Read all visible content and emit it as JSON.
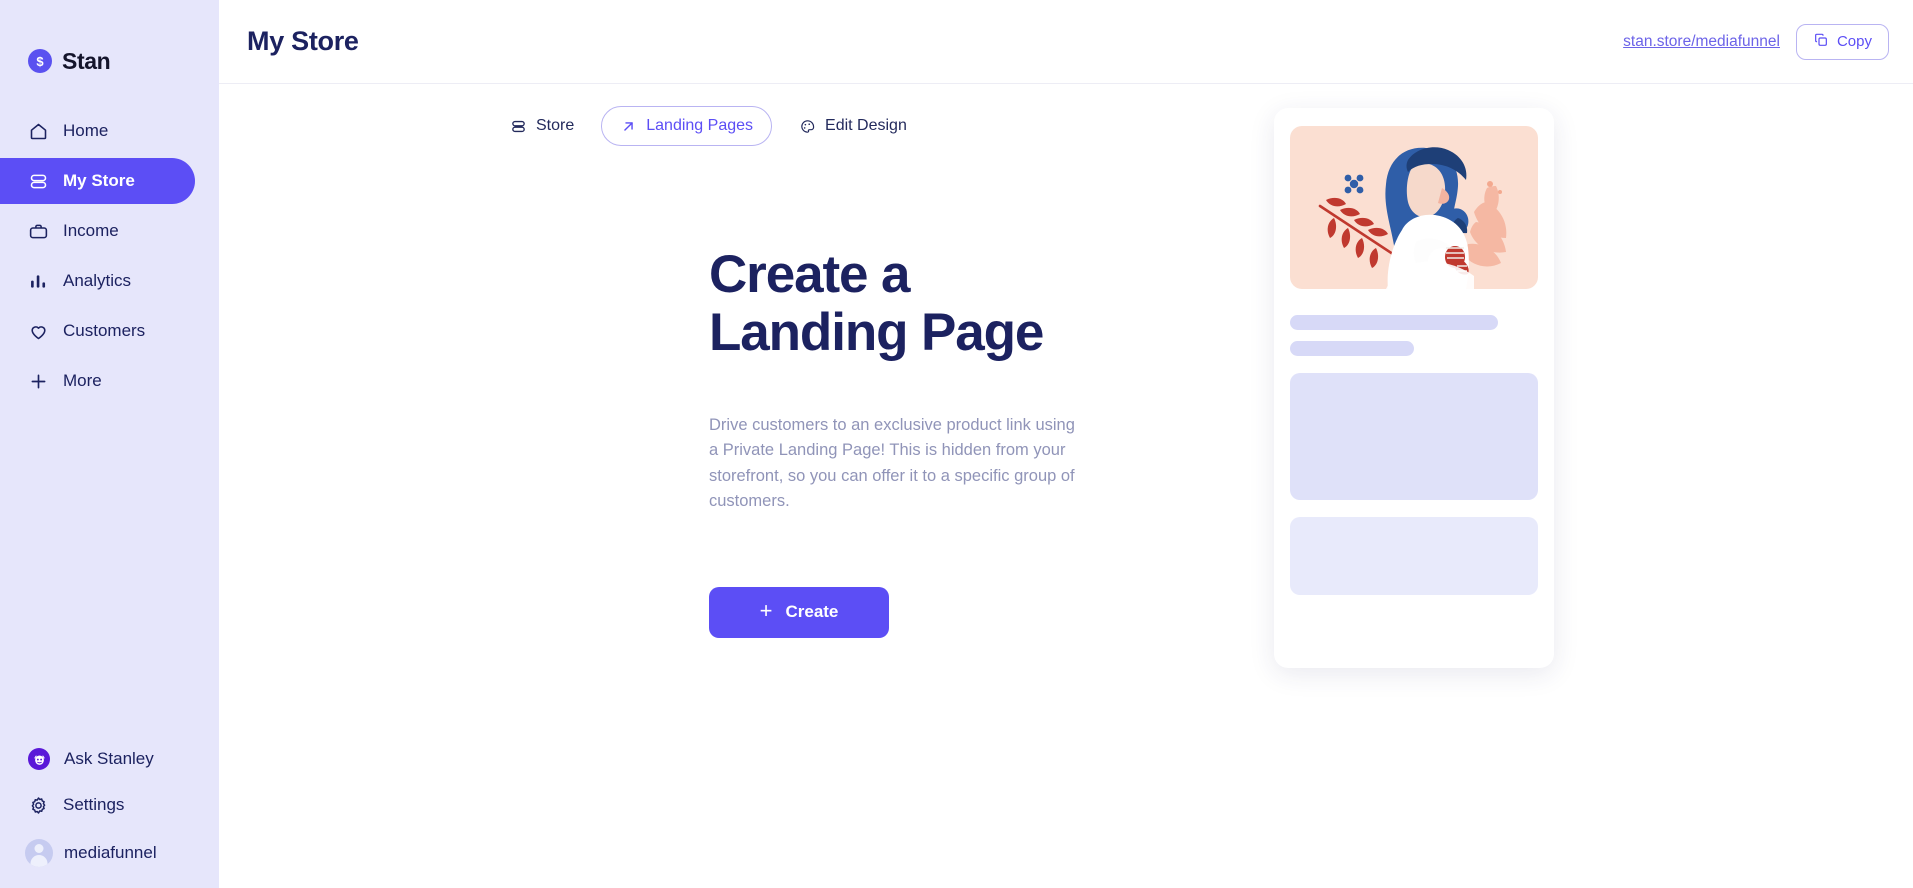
{
  "brand": {
    "name": "Stan",
    "mark_glyph": "$",
    "mark_color": "#5A51F0"
  },
  "sidebar": {
    "bg_color": "#E6E6FB",
    "active_color": "#5C4EF5",
    "items": [
      {
        "label": "Home",
        "icon": "home-icon",
        "active": false
      },
      {
        "label": "My Store",
        "icon": "store-icon",
        "active": true
      },
      {
        "label": "Income",
        "icon": "briefcase-icon",
        "active": false
      },
      {
        "label": "Analytics",
        "icon": "bar-chart-icon",
        "active": false
      },
      {
        "label": "Customers",
        "icon": "heart-icon",
        "active": false
      },
      {
        "label": "More",
        "icon": "plus-icon",
        "active": false
      }
    ],
    "bottom": [
      {
        "label": "Ask Stanley",
        "icon": "stanley-avatar-icon"
      },
      {
        "label": "Settings",
        "icon": "gear-icon"
      }
    ],
    "user": {
      "name": "mediafunnel",
      "icon": "avatar-icon"
    }
  },
  "header": {
    "title": "My Store",
    "store_url": "stan.store/mediafunnel",
    "copy_label": "Copy",
    "copy_icon": "copy-icon"
  },
  "tabs": [
    {
      "label": "Store",
      "icon": "store-icon",
      "active": false
    },
    {
      "label": "Landing Pages",
      "icon": "arrow-up-right-icon",
      "active": true
    },
    {
      "label": "Edit Design",
      "icon": "palette-icon",
      "active": false
    }
  ],
  "hero": {
    "title": "Create a Landing Page",
    "description": "Drive customers to an exclusive product link using a Private Landing Page! This is hidden from your storefront, so you can offer it to a specific group of customers.",
    "create_label": "Create",
    "create_icon": "plus-icon",
    "accent_color": "#5C4EF5"
  },
  "preview": {
    "illustration_alt": "woman-with-flowers-illustration",
    "image_bg": "#FBDFD2",
    "skeleton_color": "#D7D9F7",
    "block_color": "#DFE1F9"
  }
}
